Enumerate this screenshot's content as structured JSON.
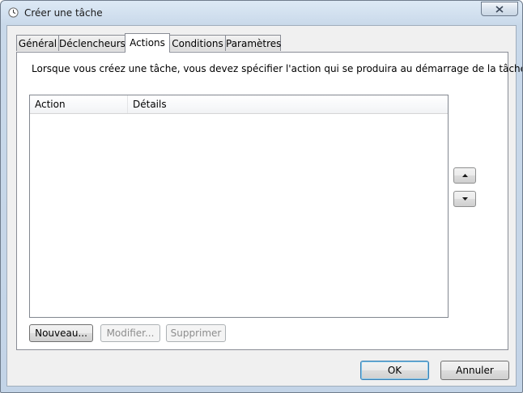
{
  "window": {
    "title": "Créer une tâche"
  },
  "tabs": [
    {
      "label": "Général",
      "active": false
    },
    {
      "label": "Déclencheurs",
      "active": false
    },
    {
      "label": "Actions",
      "active": true
    },
    {
      "label": "Conditions",
      "active": false
    },
    {
      "label": "Paramètres",
      "active": false
    }
  ],
  "actions_tab": {
    "description": "Lorsque vous créez une tâche, vous devez spécifier l'action qui se produira au démarrage de la tâche.",
    "columns": [
      "Action",
      "Détails"
    ],
    "rows": [],
    "buttons": {
      "new": "Nouveau...",
      "edit": "Modifier...",
      "delete": "Supprimer"
    }
  },
  "footer": {
    "ok": "OK",
    "cancel": "Annuler"
  },
  "icons": {
    "window_icon": "task-scheduler-clock-icon",
    "close": "close-icon",
    "move_up": "arrow-up-icon",
    "move_down": "arrow-down-icon"
  }
}
